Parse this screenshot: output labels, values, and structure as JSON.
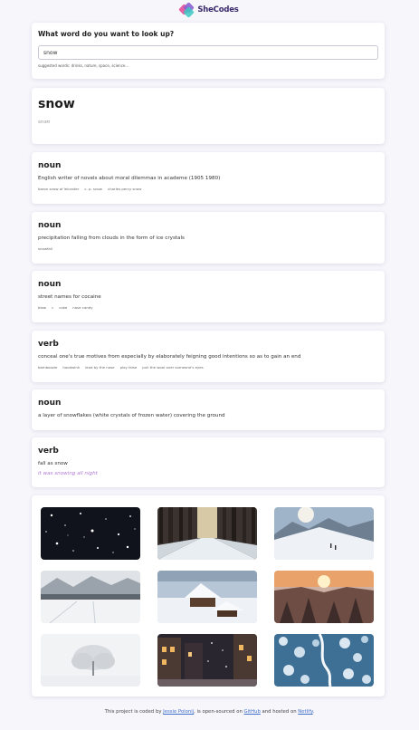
{
  "brand": {
    "name": "SheCodes"
  },
  "search": {
    "title": "What word do you want to look up?",
    "value": "snow",
    "hint": "suggested words: drinks, nature, space, science..."
  },
  "header": {
    "word": "snow",
    "phonetic": "snəʊ"
  },
  "meanings": [
    {
      "pos": "noun",
      "definition": "English writer of novels about moral dilemmas in academe (1905 1980)",
      "synonyms": [
        "baron snow of leicester",
        "c. p. snow",
        "charles percy snow"
      ],
      "example": ""
    },
    {
      "pos": "noun",
      "definition": "precipitation falling from clouds in the form of ice crystals",
      "synonyms": [
        "snowfall"
      ],
      "example": ""
    },
    {
      "pos": "noun",
      "definition": "street names for cocaine",
      "synonyms": [
        "blow",
        "c",
        "coke",
        "nose candy"
      ],
      "example": ""
    },
    {
      "pos": "verb",
      "definition": "conceal one's true motives from especially by elaborately feigning good intentions so as to gain an end",
      "synonyms": [
        "bamboozle",
        "hoodwink",
        "lead by the nose",
        "play false",
        "pull the wool over someone's eyes"
      ],
      "example": ""
    },
    {
      "pos": "noun",
      "definition": "a layer of snowflakes (white crystals of frozen water) covering the ground",
      "synonyms": [],
      "example": ""
    },
    {
      "pos": "verb",
      "definition": "fall as snow",
      "synonyms": [],
      "example": "it was snowing all night"
    }
  ],
  "photos": [
    {
      "name": "snowflakes-night-photo"
    },
    {
      "name": "snowy-forest-road-photo"
    },
    {
      "name": "snowy-mountain-skiers-photo"
    },
    {
      "name": "snowy-field-mountains-photo"
    },
    {
      "name": "snow-covered-cabin-photo"
    },
    {
      "name": "sunset-snowy-forest-photo"
    },
    {
      "name": "frosted-tree-fog-photo"
    },
    {
      "name": "snowy-city-street-photo"
    },
    {
      "name": "aerial-snowy-forest-photo"
    }
  ],
  "footer": {
    "t1": "This project is coded by ",
    "author": "Jessie Polonij",
    "t2": ", is open-sourced on ",
    "github": "GitHub",
    "t3": " and hosted on ",
    "netlify": "Netlify",
    "t4": "."
  },
  "colors": {
    "accent": "#b07ad6",
    "link": "#3d6ec9",
    "background": "#f7f6fb"
  }
}
